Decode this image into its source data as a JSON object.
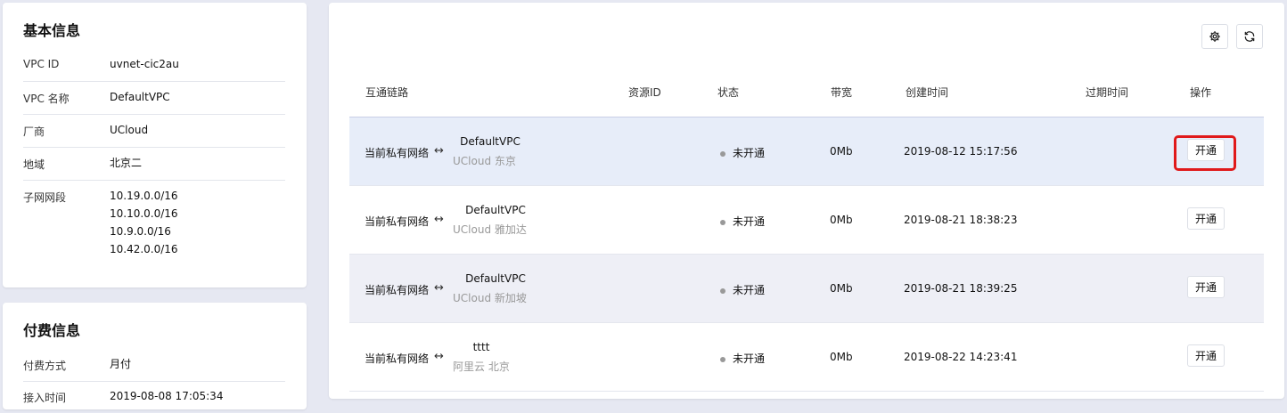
{
  "basic_info": {
    "title": "基本信息",
    "rows": [
      {
        "label": "VPC ID",
        "values": [
          "uvnet-cic2au"
        ]
      },
      {
        "label": "VPC 名称",
        "values": [
          "DefaultVPC"
        ]
      },
      {
        "label": "厂商",
        "values": [
          "UCloud"
        ]
      },
      {
        "label": "地域",
        "values": [
          "北京二"
        ]
      },
      {
        "label": "子网网段",
        "values": [
          "10.19.0.0/16",
          "10.10.0.0/16",
          "10.9.0.0/16",
          "10.42.0.0/16"
        ]
      }
    ]
  },
  "billing": {
    "title": "付费信息",
    "rows": [
      {
        "label": "付费方式",
        "value": "月付"
      },
      {
        "label": "接入时间",
        "value": "2019-08-08 17:05:34"
      }
    ]
  },
  "toolbar": {
    "settings_icon": "gear-icon",
    "refresh_icon": "refresh-icon"
  },
  "table": {
    "headers": {
      "link": "互通链路",
      "resource_id": "资源ID",
      "status": "状态",
      "bandwidth": "带宽",
      "created": "创建时间",
      "expire": "过期时间",
      "ops": "操作"
    },
    "rows": [
      {
        "local": "当前私有网络",
        "arrow": "↔",
        "peer_name": "DefaultVPC",
        "peer_region": "UCloud 东京",
        "status": "未开通",
        "bandwidth": "0Mb",
        "created": "2019-08-12 15:17:56",
        "action": "开通"
      },
      {
        "local": "当前私有网络",
        "arrow": "↔",
        "peer_name": "DefaultVPC",
        "peer_region": "UCloud 雅加达",
        "status": "未开通",
        "bandwidth": "0Mb",
        "created": "2019-08-21 18:38:23",
        "action": "开通"
      },
      {
        "local": "当前私有网络",
        "arrow": "↔",
        "peer_name": "DefaultVPC",
        "peer_region": "UCloud 新加坡",
        "status": "未开通",
        "bandwidth": "0Mb",
        "created": "2019-08-21 18:39:25",
        "action": "开通"
      },
      {
        "local": "当前私有网络",
        "arrow": "↔",
        "peer_name": "tttt",
        "peer_region": "阿里云 北京",
        "status": "未开通",
        "bandwidth": "0Mb",
        "created": "2019-08-22 14:23:41",
        "action": "开通"
      }
    ]
  }
}
